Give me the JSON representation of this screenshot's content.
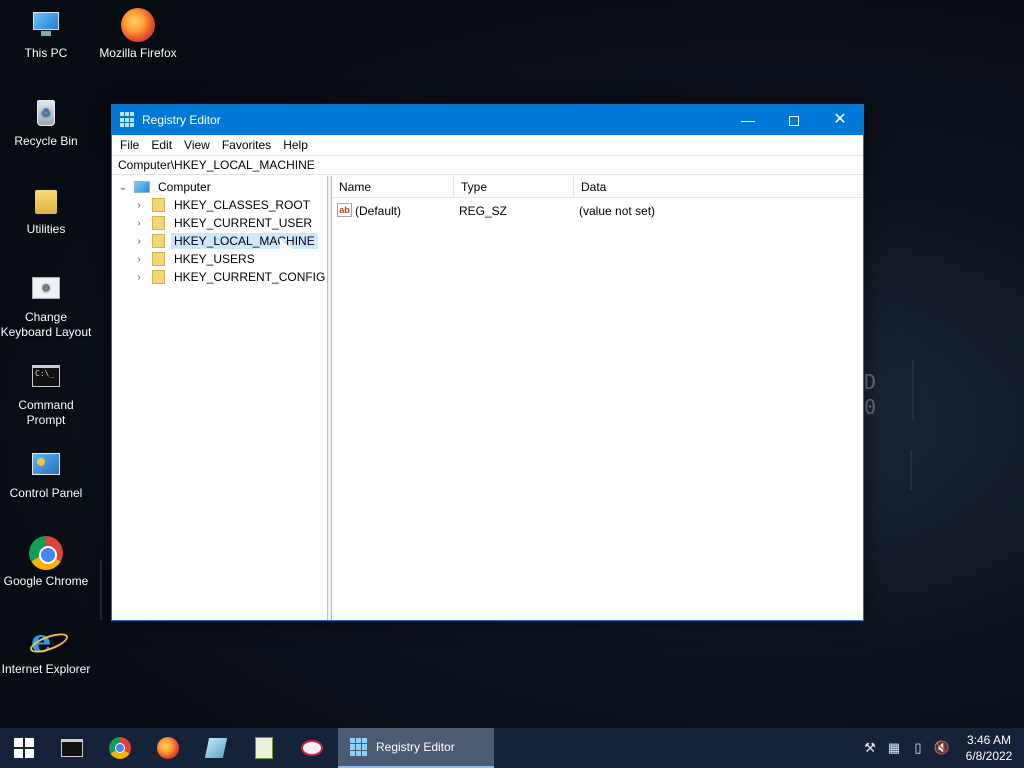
{
  "desktop": {
    "icons": [
      {
        "label": "This PC"
      },
      {
        "label": "Mozilla Firefox"
      },
      {
        "label": "Recycle Bin"
      },
      {
        "label": "Utilities"
      },
      {
        "label": "Change Keyboard Layout"
      },
      {
        "label": "Command Prompt"
      },
      {
        "label": "Control Panel"
      },
      {
        "label": "Google Chrome"
      },
      {
        "label": "Internet Explorer"
      }
    ],
    "background_glyphs": [
      "D",
      "0"
    ]
  },
  "window": {
    "title": "Registry Editor",
    "buttons": {
      "minimize": "—",
      "close": "✕"
    },
    "menu": [
      "File",
      "Edit",
      "View",
      "Favorites",
      "Help"
    ],
    "address": "Computer\\HKEY_LOCAL_MACHINE",
    "tree": {
      "root": "Computer",
      "items": [
        {
          "label": "HKEY_CLASSES_ROOT"
        },
        {
          "label": "HKEY_CURRENT_USER"
        },
        {
          "label": "HKEY_LOCAL_MACHINE",
          "selected": true
        },
        {
          "label": "HKEY_USERS"
        },
        {
          "label": "HKEY_CURRENT_CONFIG"
        }
      ]
    },
    "list": {
      "columns": [
        "Name",
        "Type",
        "Data"
      ],
      "rows": [
        {
          "icon": "ab",
          "name": "(Default)",
          "type": "REG_SZ",
          "data": "(value not set)"
        }
      ]
    }
  },
  "taskbar": {
    "pinned": [
      "start-button",
      "command-prompt",
      "google-chrome",
      "mozilla-firefox",
      "glass-app",
      "notepad-plus",
      "snipping-tool"
    ],
    "active_task": "Registry Editor",
    "clock": {
      "time": "3:46 AM",
      "date": "6/8/2022"
    }
  },
  "colors": {
    "titlebar": "#0078d7",
    "selection": "#cce8ff",
    "taskbar": "#14233a"
  }
}
